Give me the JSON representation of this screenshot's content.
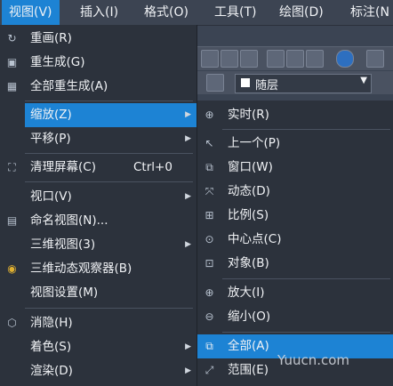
{
  "menubar": [
    "视图(V)",
    "插入(I)",
    "格式(O)",
    "工具(T)",
    "绘图(D)",
    "标注(N"
  ],
  "layer": {
    "value": "随层"
  },
  "view_menu": {
    "items": [
      {
        "label": "重画(R)",
        "icon": "redraw-icon"
      },
      {
        "label": "重生成(G)",
        "icon": "regen-icon"
      },
      {
        "label": "全部重生成(A)",
        "icon": "regen-all-icon"
      },
      {
        "label": "缩放(Z)",
        "icon": "",
        "submenu": true,
        "selected": true
      },
      {
        "label": "平移(P)",
        "icon": "",
        "submenu": true
      },
      {
        "label": "清理屏幕(C)",
        "icon": "clean-screen-icon",
        "shortcut": "Ctrl+0"
      },
      {
        "label": "视口(V)",
        "icon": "",
        "submenu": true
      },
      {
        "label": "命名视图(N)...",
        "icon": "named-view-icon"
      },
      {
        "label": "三维视图(3)",
        "icon": "",
        "submenu": true
      },
      {
        "label": "三维动态观察器(B)",
        "icon": "orbit-icon"
      },
      {
        "label": "视图设置(M)",
        "icon": ""
      },
      {
        "label": "消隐(H)",
        "icon": "hide-icon"
      },
      {
        "label": "着色(S)",
        "icon": "",
        "submenu": true
      },
      {
        "label": "渲染(D)",
        "icon": "",
        "submenu": true
      }
    ]
  },
  "zoom_menu": {
    "items": [
      {
        "label": "实时(R)",
        "icon": "zoom-realtime-icon"
      },
      {
        "label": "上一个(P)",
        "icon": "zoom-previous-icon"
      },
      {
        "label": "窗口(W)",
        "icon": "zoom-window-icon"
      },
      {
        "label": "动态(D)",
        "icon": "zoom-dynamic-icon"
      },
      {
        "label": "比例(S)",
        "icon": "zoom-scale-icon"
      },
      {
        "label": "中心点(C)",
        "icon": "zoom-center-icon"
      },
      {
        "label": "对象(B)",
        "icon": "zoom-object-icon"
      },
      {
        "label": "放大(I)",
        "icon": "zoom-in-icon"
      },
      {
        "label": "缩小(O)",
        "icon": "zoom-out-icon"
      },
      {
        "label": "全部(A)",
        "icon": "zoom-all-icon",
        "selected": true
      },
      {
        "label": "范围(E)",
        "icon": "zoom-extents-icon"
      }
    ]
  },
  "watermark": "Yuucn.com"
}
